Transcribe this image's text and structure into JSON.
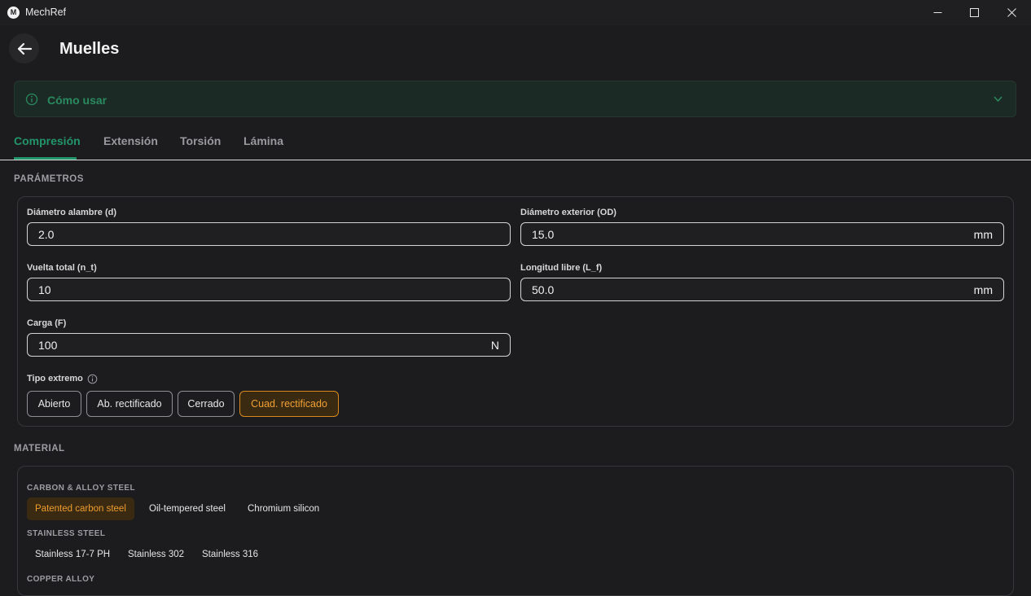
{
  "window": {
    "app_title": "MechRef",
    "logo_letter": "M"
  },
  "header": {
    "title": "Muelles"
  },
  "howto": {
    "label": "Cómo usar"
  },
  "tabs": [
    {
      "label": "Compresión",
      "active": true
    },
    {
      "label": "Extensión",
      "active": false
    },
    {
      "label": "Torsión",
      "active": false
    },
    {
      "label": "Lámina",
      "active": false
    }
  ],
  "params": {
    "section_label": "PARÁMETROS",
    "wire_diameter": {
      "label": "Diámetro alambre (d)",
      "value": "2.0",
      "unit": ""
    },
    "outer_diameter": {
      "label": "Diámetro exterior (OD)",
      "value": "15.0",
      "unit": "mm"
    },
    "total_turns": {
      "label": "Vuelta total (n_t)",
      "value": "10",
      "unit": ""
    },
    "free_length": {
      "label": "Longitud libre (L_f)",
      "value": "50.0",
      "unit": "mm"
    },
    "load": {
      "label": "Carga (F)",
      "value": "100",
      "unit": "N"
    },
    "end_type": {
      "label": "Tipo extremo",
      "options": [
        "Abierto",
        "Ab. rectificado",
        "Cerrado",
        "Cuad. rectificado"
      ],
      "selected": "Cuad. rectificado"
    }
  },
  "material": {
    "section_label": "MATERIAL",
    "categories": [
      {
        "label": "CARBON & ALLOY STEEL",
        "items": [
          "Patented carbon steel",
          "Oil-tempered steel",
          "Chromium silicon"
        ],
        "selected": "Patented carbon steel"
      },
      {
        "label": "STAINLESS STEEL",
        "items": [
          "Stainless 17-7 PH",
          "Stainless 302",
          "Stainless 316"
        ]
      },
      {
        "label": "COPPER ALLOY",
        "items": []
      }
    ]
  },
  "colors": {
    "accent_green": "#22956a",
    "accent_orange": "#f0a033",
    "background": "#1c1c1e"
  }
}
